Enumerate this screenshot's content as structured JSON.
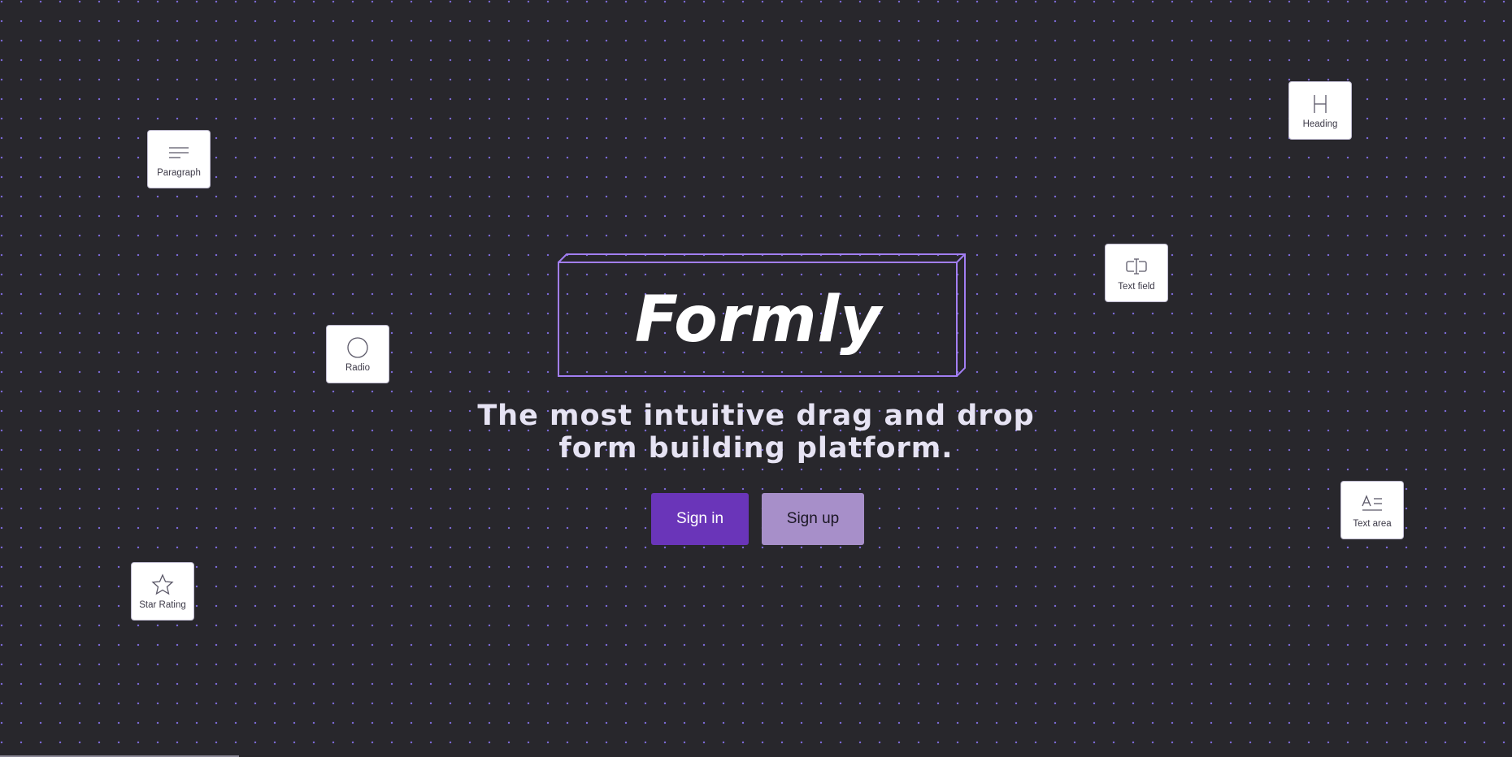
{
  "brand": {
    "name": "Formly",
    "accent_color": "#a27ef2"
  },
  "hero": {
    "tagline_line1": "The most intuitive drag and drop",
    "tagline_line2": "form building platform."
  },
  "actions": {
    "sign_in_label": "Sign in",
    "sign_up_label": "Sign up",
    "sign_in_color": "#6a35b9",
    "sign_up_color": "#a78fc9"
  },
  "components": [
    {
      "id": "paragraph",
      "label": "Paragraph",
      "icon": "paragraph-icon"
    },
    {
      "id": "heading",
      "label": "Heading",
      "icon": "heading-icon"
    },
    {
      "id": "text-field",
      "label": "Text field",
      "icon": "text-field-icon"
    },
    {
      "id": "radio",
      "label": "Radio",
      "icon": "radio-icon"
    },
    {
      "id": "text-area",
      "label": "Text area",
      "icon": "text-area-icon"
    },
    {
      "id": "star-rating",
      "label": "Star Rating",
      "icon": "star-icon"
    }
  ],
  "theme": {
    "background": "#28272c",
    "dot_color": "#7d6ad8"
  }
}
